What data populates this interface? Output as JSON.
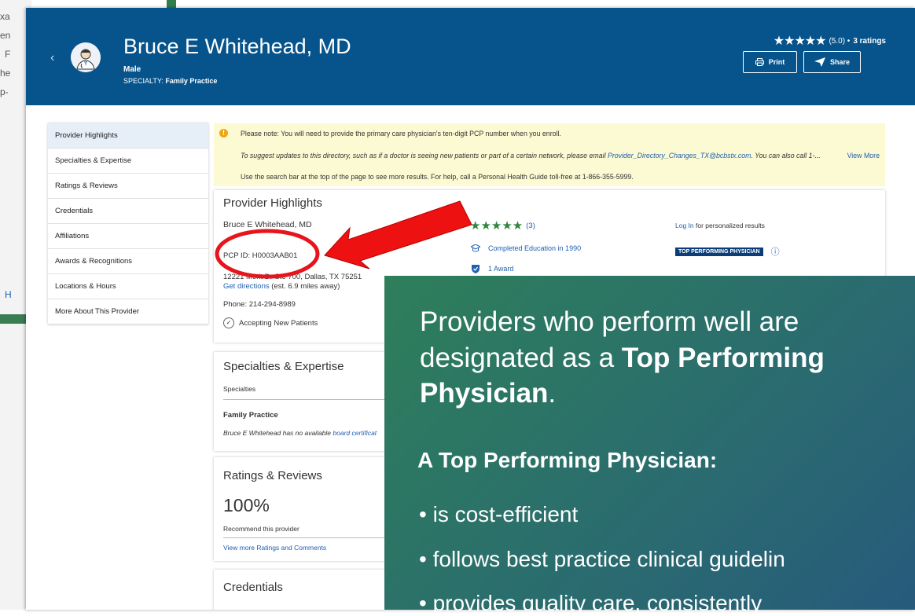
{
  "background": {
    "fragments": [
      "xa",
      "en",
      "F",
      "he",
      "p-",
      "H"
    ]
  },
  "header": {
    "name": "Bruce E Whitehead, MD",
    "gender": "Male",
    "specialty_label": "SPECIALTY:",
    "specialty_value": "Family Practice",
    "rating_stars": "★★★★★",
    "rating_score": "(5.0) •",
    "rating_count": "3 ratings",
    "print_label": "Print",
    "share_label": "Share",
    "back_icon": "chevron-left-icon"
  },
  "sidebar": {
    "items": [
      {
        "label": "Provider Highlights",
        "active": true
      },
      {
        "label": "Specialties & Expertise"
      },
      {
        "label": "Ratings & Reviews"
      },
      {
        "label": "Credentials"
      },
      {
        "label": "Affiliations"
      },
      {
        "label": "Awards & Recognitions"
      },
      {
        "label": "Locations & Hours"
      },
      {
        "label": "More About This Provider"
      }
    ]
  },
  "notice": {
    "line1": "Please note: You will need to provide the primary care physician's ten-digit PCP number when you enroll.",
    "line2": "To suggest updates to this directory, such as if a doctor is seeing new patients or part of a certain network, please email ",
    "line2_email": "Provider_Directory_Changes_TX@bcbstx.com",
    "line2_tail": ". You can also call 1-...",
    "view_more": "View More",
    "line3": "Use the search bar at the top of the page to see more results. For help, call a Personal Health Guide toll-free at 1-866-355-5999."
  },
  "highlights": {
    "title": "Provider Highlights",
    "provider_name": "Bruce E Whitehead, MD",
    "pcp_id": "PCP ID: H0003AAB01",
    "address": "12221 Merit Dr Ste 700, Dallas, TX 75251",
    "directions_link": "Get directions",
    "directions_note": "(est. 6.9 miles away)",
    "phone": "Phone: 214-294-8989",
    "accepting": "Accepting New Patients",
    "stars": "★★★★★",
    "star_count": "(3)",
    "education": "Completed Education in 1990",
    "award": "1 Award",
    "login_link": "Log In",
    "login_tail": "for personalized results",
    "badge": "TOP PERFORMING PHYSICIAN",
    "info_icon": "info-icon"
  },
  "specialties": {
    "title": "Specialties & Expertise",
    "sub": "Specialties",
    "item": "Family Practice",
    "note": "Bruce E Whitehead has no available ",
    "note_link": "board certificat"
  },
  "ratings": {
    "title": "Ratings & Reviews",
    "percent": "100%",
    "recommend": "Recommend this provider",
    "more_link": "View more Ratings and Comments"
  },
  "credentials": {
    "title": "Credentials"
  },
  "overlay": {
    "p1_a": "Providers who perform well are designated as a ",
    "p1_b": "Top Performing Physician",
    "p1_c": ".",
    "heading": "A Top Performing Physician:",
    "bullets": [
      "is cost-efficient",
      "follows best practice clinical guidelin",
      "provides quality care, consistently"
    ]
  }
}
